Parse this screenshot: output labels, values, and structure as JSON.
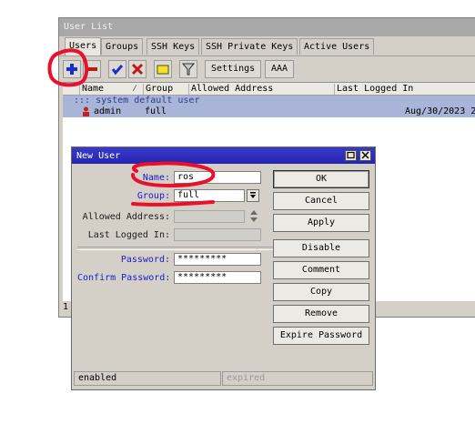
{
  "user_list": {
    "title": "User List",
    "tabs": [
      "Users",
      "Groups",
      "SSH Keys",
      "SSH Private Keys",
      "Active Users"
    ],
    "toolbar": {
      "settings_label": "Settings",
      "aaa_label": "AAA"
    },
    "columns": [
      "Name",
      "Group",
      "Allowed Address",
      "Last Logged In"
    ],
    "comment_row": "::: system default user",
    "rows": [
      {
        "name": "admin",
        "group": "full",
        "allowed_address": "",
        "last_logged_in": "Aug/30/2023 2"
      }
    ],
    "status_stub": "1"
  },
  "new_user": {
    "title": "New User",
    "labels": {
      "name": "Name:",
      "group": "Group:",
      "allowed_address": "Allowed Address:",
      "last_logged_in": "Last Logged In:",
      "password": "Password:",
      "confirm_password": "Confirm Password:"
    },
    "values": {
      "name": "ros",
      "group": "full",
      "allowed_address": "",
      "last_logged_in": "",
      "password": "*********",
      "confirm_password": "*********"
    },
    "buttons": {
      "ok": "OK",
      "cancel": "Cancel",
      "apply": "Apply",
      "disable": "Disable",
      "comment": "Comment",
      "copy": "Copy",
      "remove": "Remove",
      "expire_password": "Expire Password"
    },
    "status": {
      "left": "enabled",
      "right": "expired"
    }
  },
  "colors": {
    "annotation_red": "#e8102a",
    "dialog_title": "#2a2ab8",
    "label_blue": "#1a1ad0",
    "selected_row": "#a8b4d8"
  }
}
